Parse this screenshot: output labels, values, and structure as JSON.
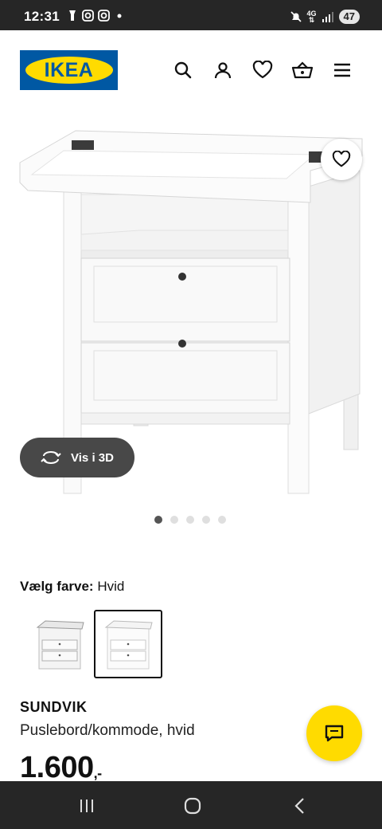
{
  "status_bar": {
    "time": "12:31",
    "network": "4G",
    "battery": "47",
    "icons_left": [
      "flashlight-icon",
      "instagram-icon",
      "instagram-icon",
      "dot-icon"
    ],
    "icons_right": [
      "mute-icon",
      "network-icon",
      "signal-icon",
      "battery-icon"
    ]
  },
  "header": {
    "logo_text": "IKEA",
    "brand_blue": "#0058a3",
    "brand_yellow": "#ffdb00",
    "icons": [
      "search-icon",
      "account-icon",
      "favorites-icon",
      "basket-icon",
      "menu-icon"
    ]
  },
  "gallery": {
    "view_3d_label": "Vis i 3D",
    "image_count": 5,
    "active_index": 0
  },
  "color_select": {
    "label": "Vælg farve:",
    "value": "Hvid",
    "selected_index": 1
  },
  "product": {
    "name": "SUNDVIK",
    "description": "Puslebord/kommode, hvid",
    "price": "1.600",
    "price_suffix": ",-"
  },
  "system_nav": {
    "buttons": [
      "recent-apps-icon",
      "home-icon",
      "back-icon"
    ]
  }
}
